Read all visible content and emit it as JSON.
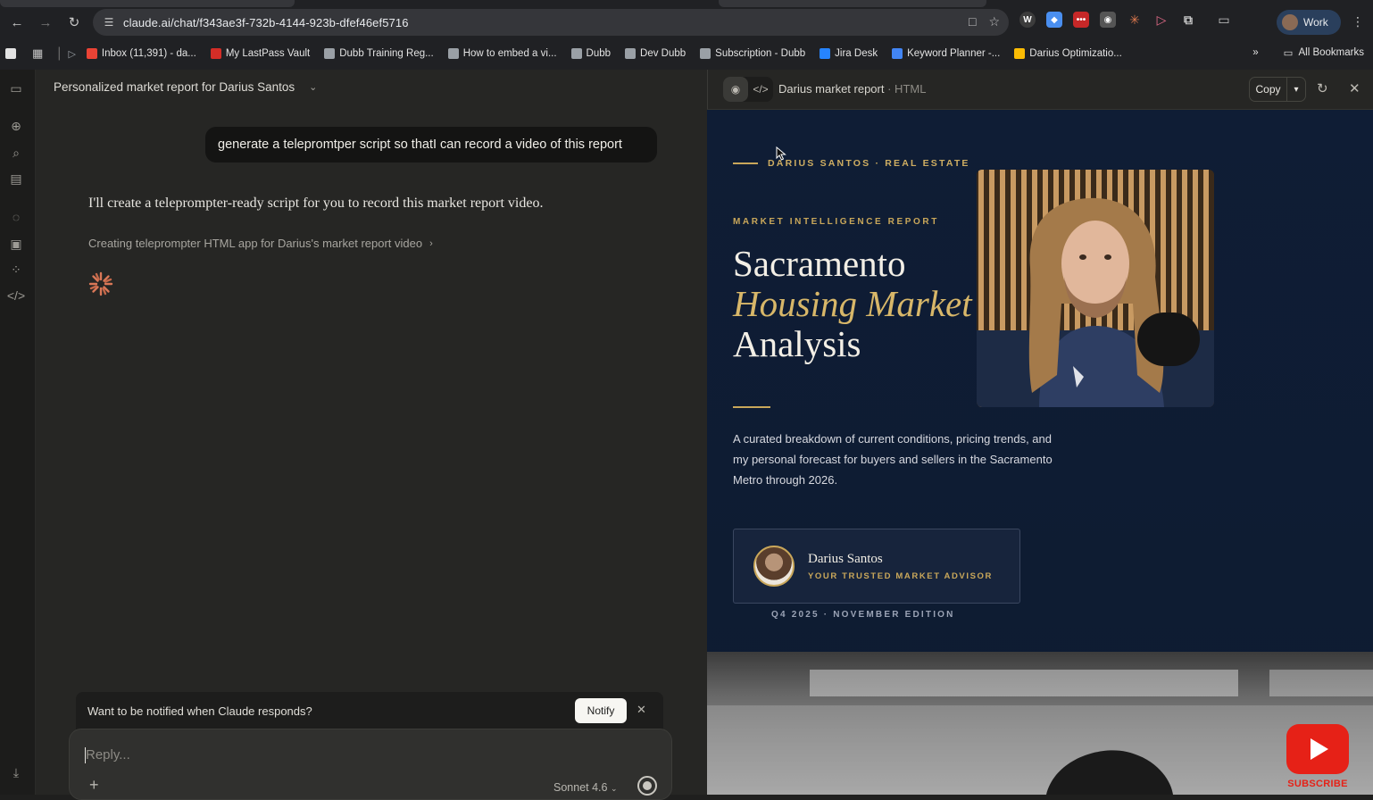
{
  "browser": {
    "url": "claude.ai/chat/f343ae3f-732b-4144-923b-dfef46ef5716",
    "profile_label": "Work",
    "bookmarks": [
      {
        "label": "Inbox (11,391) - da...",
        "color": "#ea4335"
      },
      {
        "label": "My LastPass Vault",
        "color": "#d32d27"
      },
      {
        "label": "Dubb Training Reg...",
        "color": "#9aa0a6"
      },
      {
        "label": "How to embed a vi...",
        "color": "#9aa0a6"
      },
      {
        "label": "Dubb",
        "color": "#9aa0a6"
      },
      {
        "label": "Dev Dubb",
        "color": "#9aa0a6"
      },
      {
        "label": "Subscription - Dubb",
        "color": "#9aa0a6"
      },
      {
        "label": "Jira Desk",
        "color": "#2684ff"
      },
      {
        "label": "Keyword Planner -...",
        "color": "#4285f4"
      },
      {
        "label": "Darius Optimizatio...",
        "color": "#fbbc04"
      }
    ],
    "all_bookmarks_label": "All Bookmarks"
  },
  "chat": {
    "title": "Personalized market report for Darius Santos",
    "user_message": "generate a telepromtper script so thatI can record a video of this report",
    "assistant_message": "I'll create a teleprompter-ready script for you to record this market report video.",
    "tool_status": "Creating teleprompter HTML app for Darius's market report video",
    "notify_prompt": "Want to be notified when Claude responds?",
    "notify_button": "Notify",
    "reply_placeholder": "Reply...",
    "model_label": "Sonnet 4.6"
  },
  "artifact": {
    "title": "Darius market report",
    "type_label": "· HTML",
    "copy_label": "Copy"
  },
  "report": {
    "eyebrow": "DARIUS SANTOS · REAL ESTATE",
    "kicker": "MARKET INTELLIGENCE REPORT",
    "headline_1": "Sacramento",
    "headline_2": "Housing Market",
    "headline_3": "Analysis",
    "lede": "A curated breakdown of current conditions, pricing trends, and my personal forecast for buyers and sellers in the Sacramento Metro through 2026.",
    "advisor_name": "Darius Santos",
    "advisor_role": "YOUR TRUSTED MARKET ADVISOR",
    "edition": "Q4 2025 · NOVEMBER EDITION"
  },
  "overlay": {
    "subscribe_label": "SUBSCRIBE"
  },
  "colors": {
    "accent_gold": "#c9a75a",
    "report_bg": "#0f1d35",
    "chat_bg": "#262624"
  }
}
